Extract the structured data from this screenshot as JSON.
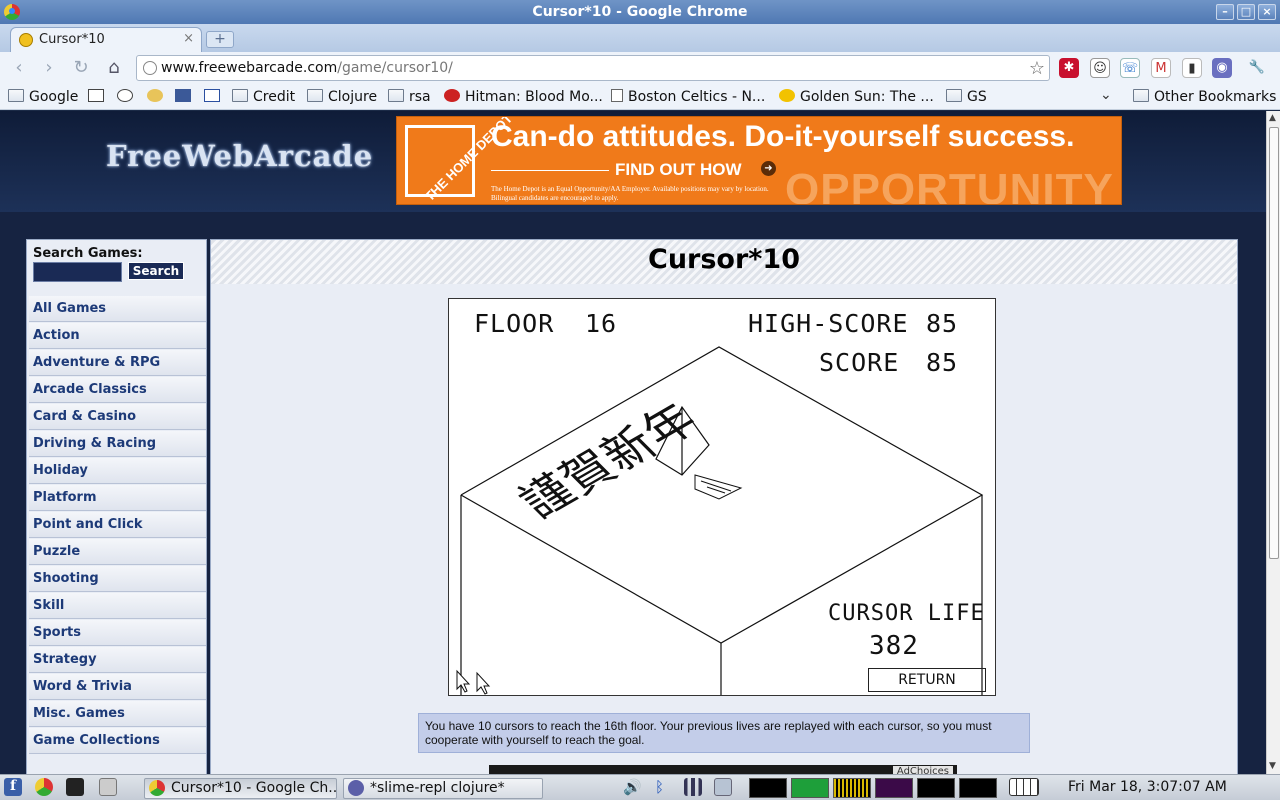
{
  "window": {
    "title": "Cursor*10 - Google Chrome"
  },
  "tab": {
    "title": "Cursor*10",
    "close": "×",
    "new_tab": "+"
  },
  "toolbar": {
    "back": "‹",
    "forward": "›",
    "reload": "↻",
    "home": "⌂",
    "url_host": "www.freewebarcade.com",
    "url_path": "/game/cursor10/",
    "star": "☆",
    "wrench": "🔧"
  },
  "bookmarks": [
    {
      "label": "Google",
      "icon": "folder-icon"
    },
    {
      "label": "",
      "icon": "calendar-icon"
    },
    {
      "label": "",
      "icon": "reddit-icon"
    },
    {
      "label": "",
      "icon": "bookmark-icon"
    },
    {
      "label": "",
      "icon": "facebook-icon"
    },
    {
      "label": "",
      "icon": "p-icon"
    },
    {
      "label": "Credit",
      "icon": "folder-icon"
    },
    {
      "label": "Clojure",
      "icon": "folder-icon"
    },
    {
      "label": "rsa",
      "icon": "folder-icon"
    },
    {
      "label": "Hitman: Blood Mo...",
      "icon": "hitman-icon"
    },
    {
      "label": "Boston Celtics - N...",
      "icon": "page-icon"
    },
    {
      "label": "Golden Sun: The ...",
      "icon": "sun-icon"
    },
    {
      "label": "GS",
      "icon": "folder-icon"
    },
    {
      "label": "Other Bookmarks",
      "icon": "folder-icon"
    }
  ],
  "site": {
    "logo": "FreeWebArcade",
    "ad": {
      "brand": "THE HOME DEPOT",
      "headline": "Can-do attitudes. Do-it-yourself success.",
      "cta": "FIND OUT HOW",
      "fine_print": "The Home Depot is an Equal Opportunity/AA Employer. Available positions may vary by location. Bilingual candidates are encouraged to apply.",
      "watermark": "OPPORTUNITY"
    },
    "search": {
      "label": "Search Games:",
      "button": "Search",
      "value": ""
    },
    "categories": [
      "All Games",
      "Action",
      "Adventure & RPG",
      "Arcade Classics",
      "Card & Casino",
      "Driving & Racing",
      "Holiday",
      "Platform",
      "Point and Click",
      "Puzzle",
      "Shooting",
      "Skill",
      "Sports",
      "Strategy",
      "Word & Trivia",
      "Misc. Games",
      "Game Collections"
    ]
  },
  "game": {
    "title": "Cursor*10",
    "floor_label": "FLOOR",
    "floor": "16",
    "highscore_label": "HIGH-SCORE",
    "highscore": "85",
    "score_label": "SCORE",
    "score": "85",
    "cursor_life_label": "CURSOR LIFE",
    "cursor_life": "382",
    "return": "RETURN",
    "banner": "謹賀新年",
    "description": "You have 10 cursors to reach the 16th floor. Your previous lives are replayed with each cursor, so you must cooperate with yourself to reach the goal.",
    "adchoices": "AdChoices"
  },
  "taskbar": {
    "items": [
      "Cursor*10 - Google Ch...",
      "*slime-repl clojure*"
    ],
    "clock": "Fri Mar 18,  3:07:07 AM"
  }
}
